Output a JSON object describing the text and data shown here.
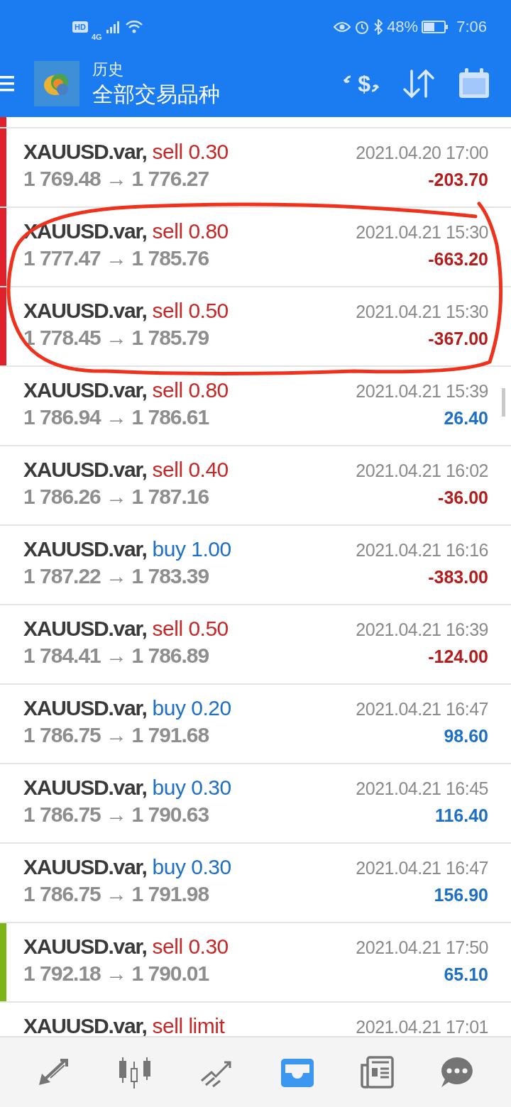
{
  "status_bar": {
    "hd": "HD",
    "network": "4G",
    "battery": "48%",
    "time": "7:06"
  },
  "header": {
    "subtitle": "历史",
    "title": "全部交易品种",
    "exchange_symbol": "$"
  },
  "trades": [
    {
      "symbol": "XAUUSD.var,",
      "kind": "sell",
      "order": "sell 0.30",
      "prices": "1 769.48 → 1 776.27",
      "time": "2021.04.20 17:00",
      "profit": "-203.70",
      "loss": true,
      "color": "#e0202a"
    },
    {
      "symbol": "XAUUSD.var,",
      "kind": "sell",
      "order": "sell 0.80",
      "prices": "1 777.47 → 1 785.76",
      "time": "2021.04.21 15:30",
      "profit": "-663.20",
      "loss": true,
      "color": "#e0202a"
    },
    {
      "symbol": "XAUUSD.var,",
      "kind": "sell",
      "order": "sell 0.50",
      "prices": "1 778.45 → 1 785.79",
      "time": "2021.04.21 15:30",
      "profit": "-367.00",
      "loss": true,
      "color": "#e0202a"
    },
    {
      "symbol": "XAUUSD.var,",
      "kind": "sell",
      "order": "sell 0.80",
      "prices": "1 786.94 → 1 786.61",
      "time": "2021.04.21 15:39",
      "profit": "26.40",
      "loss": false
    },
    {
      "symbol": "XAUUSD.var,",
      "kind": "sell",
      "order": "sell 0.40",
      "prices": "1 786.26 → 1 787.16",
      "time": "2021.04.21 16:02",
      "profit": "-36.00",
      "loss": true
    },
    {
      "symbol": "XAUUSD.var,",
      "kind": "buy",
      "order": "buy 1.00",
      "prices": "1 787.22 → 1 783.39",
      "time": "2021.04.21 16:16",
      "profit": "-383.00",
      "loss": true
    },
    {
      "symbol": "XAUUSD.var,",
      "kind": "sell",
      "order": "sell 0.50",
      "prices": "1 784.41 → 1 786.89",
      "time": "2021.04.21 16:39",
      "profit": "-124.00",
      "loss": true
    },
    {
      "symbol": "XAUUSD.var,",
      "kind": "buy",
      "order": "buy 0.20",
      "prices": "1 786.75 → 1 791.68",
      "time": "2021.04.21 16:47",
      "profit": "98.60",
      "loss": false
    },
    {
      "symbol": "XAUUSD.var,",
      "kind": "buy",
      "order": "buy 0.30",
      "prices": "1 786.75 → 1 790.63",
      "time": "2021.04.21 16:45",
      "profit": "116.40",
      "loss": false
    },
    {
      "symbol": "XAUUSD.var,",
      "kind": "buy",
      "order": "buy 0.30",
      "prices": "1 786.75 → 1 791.98",
      "time": "2021.04.21 16:47",
      "profit": "156.90",
      "loss": false
    },
    {
      "symbol": "XAUUSD.var,",
      "kind": "sell",
      "order": "sell 0.30",
      "prices": "1 792.18 → 1 790.01",
      "time": "2021.04.21 17:50",
      "profit": "65.10",
      "loss": false,
      "color": "#7cb518"
    },
    {
      "symbol": "XAUUSD.var,",
      "kind": "sell",
      "order": "sell limit",
      "time": "2021.04.21 17:01"
    }
  ],
  "nav": [
    {
      "kind": "trade",
      "selected": false
    },
    {
      "kind": "chart",
      "selected": false
    },
    {
      "kind": "quotes",
      "selected": false
    },
    {
      "kind": "history",
      "selected": true
    },
    {
      "kind": "news",
      "selected": false
    },
    {
      "kind": "chat",
      "selected": false
    }
  ]
}
